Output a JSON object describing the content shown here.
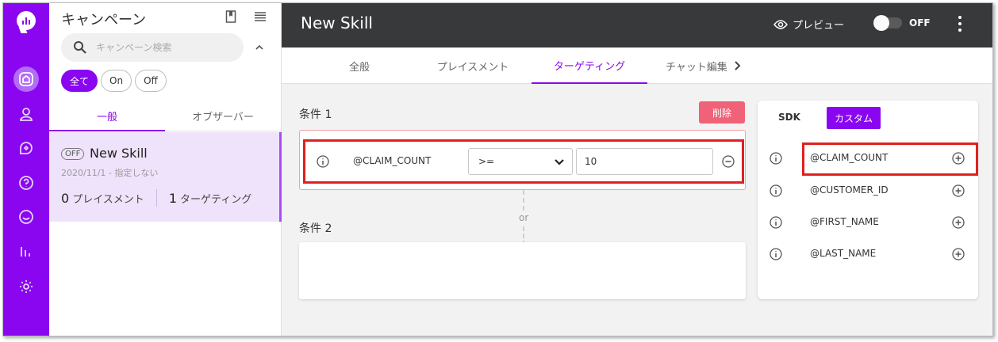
{
  "sidebar": {
    "title": "キャンペーン",
    "search_placeholder": "キャンペーン検索",
    "filters": [
      "全て",
      "On",
      "Off"
    ],
    "tabs": [
      "一般",
      "オブザーバー"
    ],
    "campaign": {
      "status": "OFF",
      "name": "New Skill",
      "date": "2020/11/1 - 指定しない",
      "placements_count": "0",
      "placements_label": "プレイスメント",
      "targeting_count": "1",
      "targeting_label": "ターゲティング"
    }
  },
  "header": {
    "title": "New Skill",
    "preview_label": "プレビュー",
    "toggle_label": "OFF"
  },
  "tabs": [
    "全般",
    "プレイスメント",
    "ターゲティング",
    "チャット編集"
  ],
  "conditions": {
    "condition1_label": "条件 1",
    "delete_label": "削除",
    "row": {
      "variable": "@CLAIM_COUNT",
      "operator": ">=",
      "value": "10"
    },
    "or_label": "or",
    "condition2_label": "条件 2"
  },
  "variables": {
    "tab_sdk": "SDK",
    "tab_custom": "カスタム",
    "items": [
      "@CLAIM_COUNT",
      "@CUSTOMER_ID",
      "@FIRST_NAME",
      "@LAST_NAME"
    ]
  },
  "colors": {
    "accent": "#8a06f0",
    "header_bg": "#37393b",
    "delete": "#f06277",
    "highlight": "#e02020"
  }
}
